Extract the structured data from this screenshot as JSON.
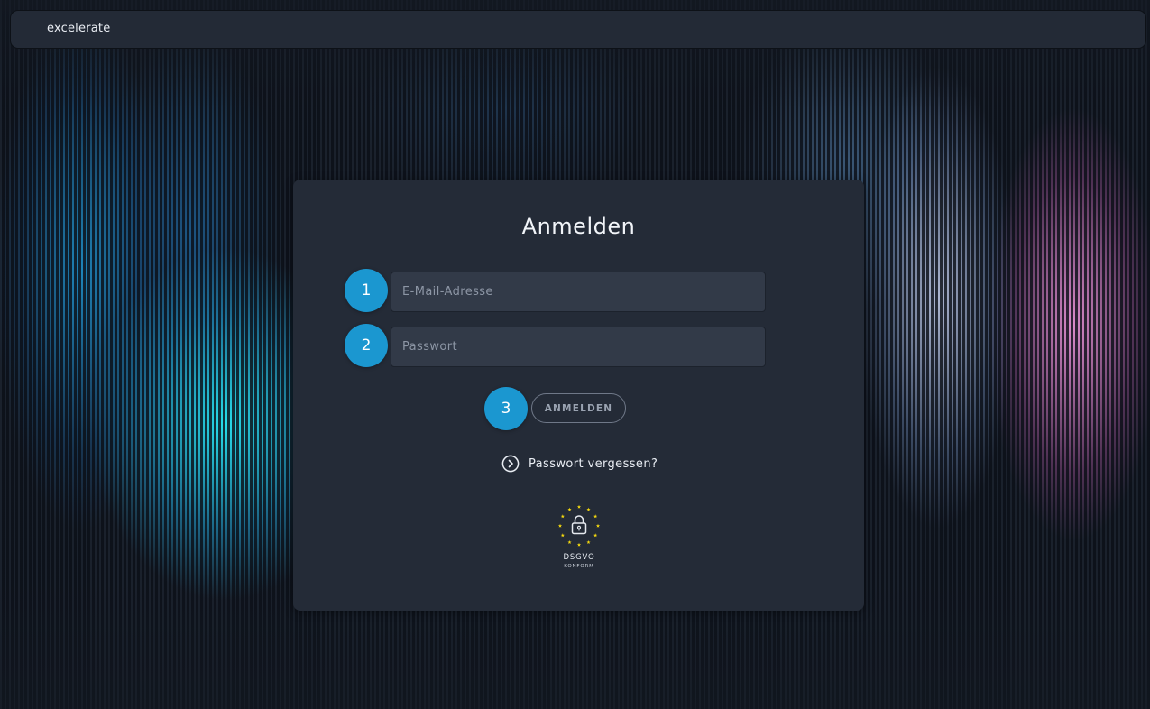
{
  "app": {
    "brand": "excelerate"
  },
  "login": {
    "title": "Anmelden",
    "email_placeholder": "E-Mail-Adresse",
    "email_value": "",
    "password_placeholder": "Passwort",
    "password_value": "",
    "submit_label": "ANMELDEN",
    "forgot_password_label": "Passwort vergessen?",
    "forgot_password_icon": "chevron-right-circle-icon"
  },
  "steps": [
    "1",
    "2",
    "3"
  ],
  "gdpr_badge": {
    "title": "DSGVO",
    "subtitle": "KONFORM",
    "icon": "lock-icon",
    "star_color": "#f5d90f"
  },
  "colors": {
    "accent": "#1b97d0",
    "card": "#242b37",
    "field": "#323a48"
  }
}
